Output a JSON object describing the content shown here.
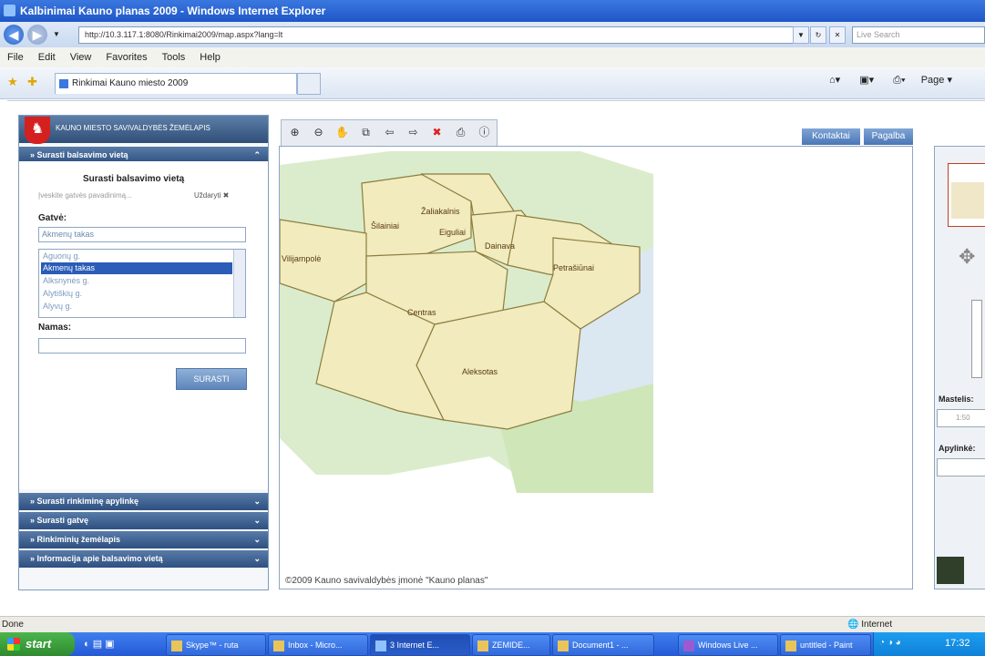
{
  "window": {
    "title": "Kalbinimai Kauno planas 2009 - Windows Internet Explorer"
  },
  "address": {
    "url": "http://10.3.117.1:8080/Rinkimai2009/map.aspx?lang=lt",
    "search_placeholder": "Live Search"
  },
  "menubar": {
    "items": [
      "File",
      "Edit",
      "View",
      "Favorites",
      "Tools",
      "Help"
    ]
  },
  "tab": {
    "title": "Rinkimai Kauno miesto 2009"
  },
  "command_bar": {
    "page_label": "Page"
  },
  "panel": {
    "logo_text": "KAUNO MIESTO SAVIVALDYBĖS ŽEMĖLAPIS",
    "section_find_place": "Surasti balsavimo vietą",
    "form_title": "Surasti balsavimo vietą",
    "hint": "Įveskite gatvės pavadinimą...",
    "hint_right": "Uždaryti",
    "street_label": "Gatvė:",
    "street_value": "Akmenų takas",
    "street_options": [
      "Aguonų g.",
      "Akmenų takas",
      "Alksnynės g.",
      "Alytiškių g.",
      "Alyvų g."
    ],
    "selected_index": 1,
    "house_label": "Namas:",
    "house_value": "",
    "find_button": "SURASTI",
    "section_district": "Surasti rinkiminę apylinkę",
    "section_street": "Surasti gatvę",
    "section_map": "Rinkiminių žemėlapis",
    "section_info": "Informacija apie balsavimo vietą"
  },
  "header_buttons": {
    "contacts": "Kontaktai",
    "help": "Pagalba"
  },
  "map": {
    "districts": [
      "Šilainiai",
      "Žaliakalnis",
      "Vilijampolė",
      "Dainava",
      "Eiguliai",
      "Petrašiūnai",
      "Centras",
      "Aleksotas"
    ],
    "copyright": "©2009 Kauno savivaldybės įmonė \"Kauno planas\"",
    "colors": {
      "district_fill": "#f2ebc1",
      "district_border": "#8a7a3a",
      "forest": "#d4ebc4",
      "water": "#dce8f2"
    }
  },
  "right_panel": {
    "scale_label": "Mastelis:",
    "scale_value": "1:50",
    "district_label": "Apylinkė:"
  },
  "status": {
    "left": "Done",
    "zone": "Internet"
  },
  "taskbar": {
    "start": "start",
    "tasks": [
      "Skype™ - ruta",
      "Inbox - Micro...",
      "3 Internet E...",
      "ZEMIDE...",
      "Document1 - ...",
      "Windows Live ...",
      "untitled - Paint"
    ],
    "active_index": 2,
    "clock": "17:32"
  }
}
